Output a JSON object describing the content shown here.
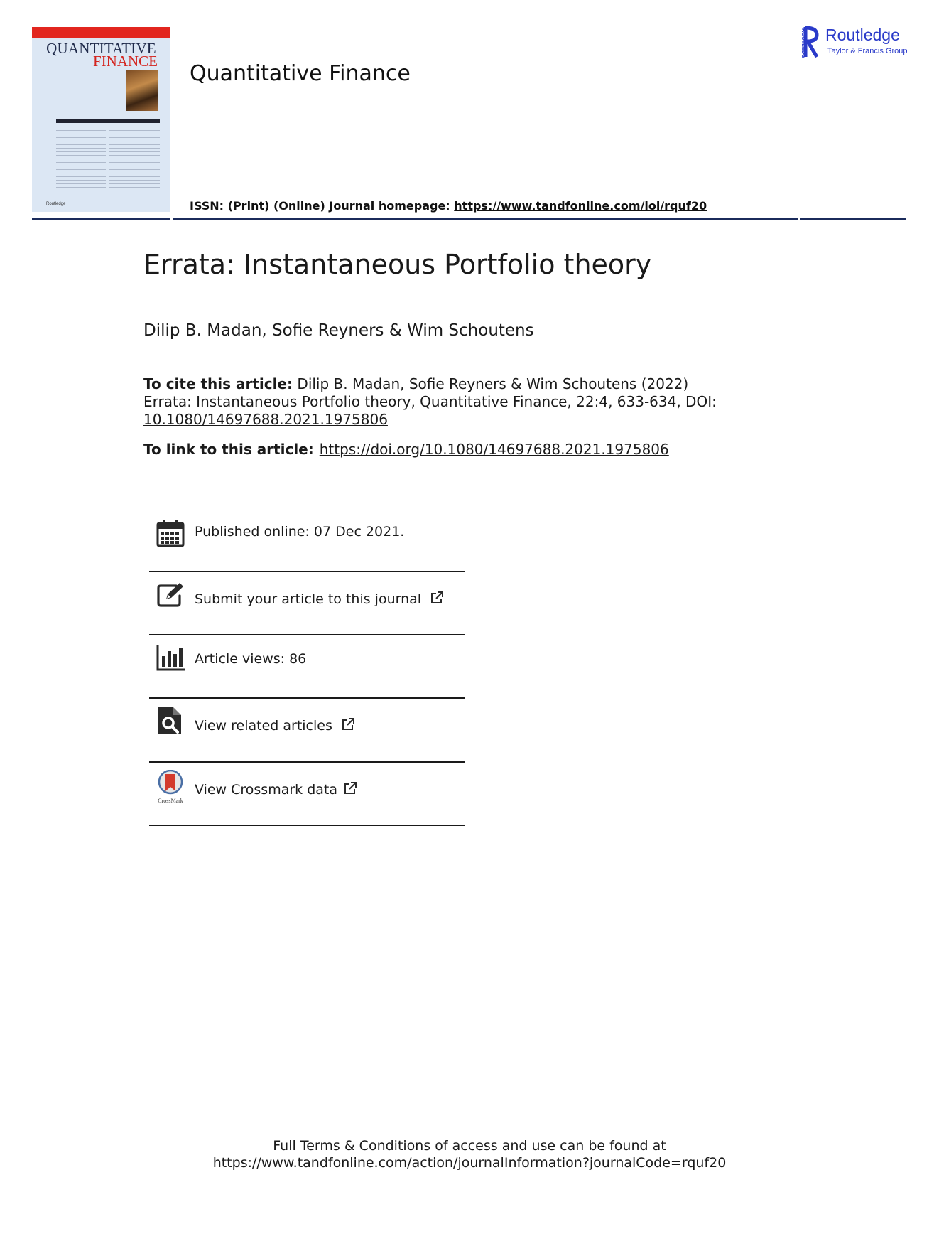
{
  "cover": {
    "title_line1": "QUANTITATIVE",
    "title_line2": "FINANCE",
    "publisher_mark": "Routledge"
  },
  "journal": {
    "name": "Quantitative Finance",
    "issn_prefix": "ISSN: (Print) (Online) Journal homepage: ",
    "homepage_url": "https://www.tandfonline.com/loi/rquf20"
  },
  "publisher_logo": {
    "name": "Routledge",
    "group": "Taylor & Francis Group",
    "vertical_text": "ROUTLEDGE"
  },
  "article": {
    "title": "Errata: Instantaneous Portfolio theory",
    "authors": "Dilip B. Madan, Sofie Reyners & Wim Schoutens"
  },
  "cite": {
    "label": "To cite this article:",
    "line1": " Dilip B. Madan, Sofie Reyners & Wim Schoutens (2022)",
    "line2": "Errata: Instantaneous Portfolio theory, Quantitative Finance, 22:4, 633-634, DOI:",
    "doi": "10.1080/14697688.2021.1975806"
  },
  "link": {
    "label": "To link to this article:",
    "url": "https://doi.org/10.1080/14697688.2021.1975806"
  },
  "info_items": {
    "published": "Published online: 07 Dec 2021.",
    "submit": "Submit your article to this journal",
    "views": "Article views: 86",
    "related": "View related articles",
    "crossmark": "View Crossmark data",
    "crossmark_caption": "CrossMark"
  },
  "footer": {
    "line1": "Full Terms & Conditions of access and use can be found at",
    "line2": "https://www.tandfonline.com/action/journalInformation?journalCode=rquf20"
  },
  "colors": {
    "rule": "#1b2b5b",
    "routledge_blue": "#2a3ac9",
    "cover_red": "#e2261f",
    "cover_bg": "#dce7f4"
  }
}
